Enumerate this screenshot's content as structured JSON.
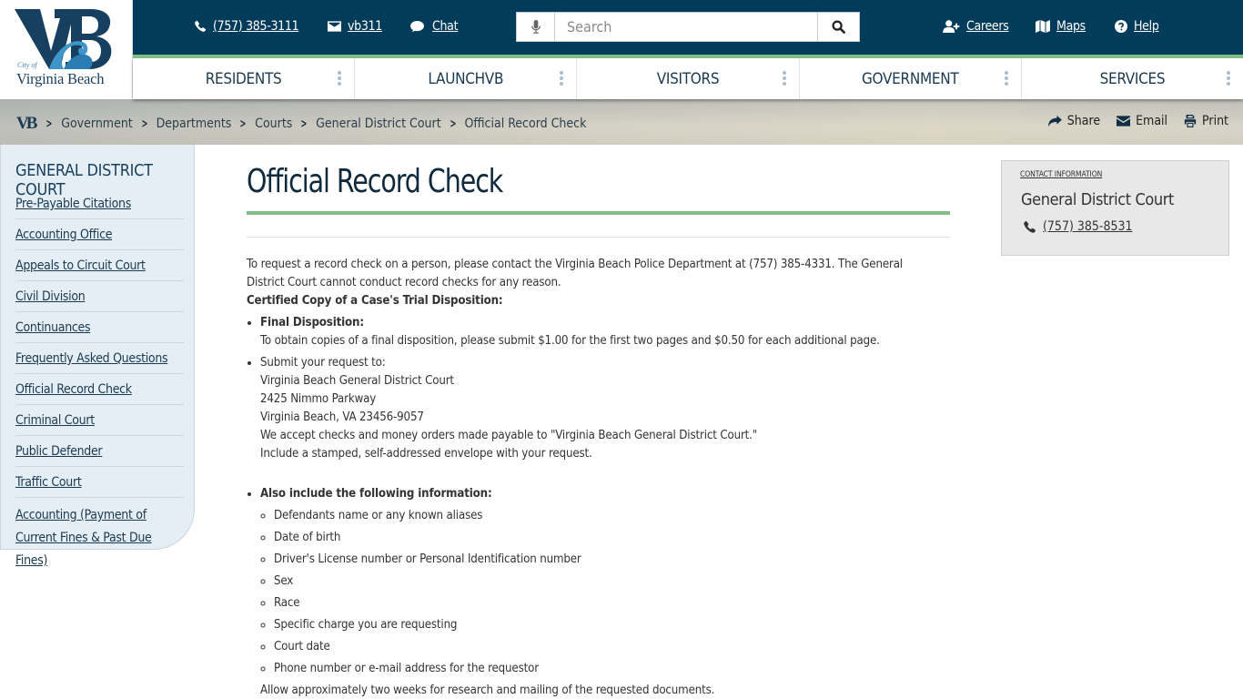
{
  "brand": {
    "logo_monogram": "VB",
    "city_of": "City of",
    "name": "Virginia Beach",
    "colors": {
      "navy": "#033c5a",
      "green_accent": "#7fbf87",
      "sidebar_bg": "#e6eef5",
      "contact_bg": "#e8e8e8"
    }
  },
  "utility": {
    "phone": {
      "icon": "phone-icon",
      "label": "(757) 385-3111"
    },
    "email": {
      "icon": "envelope-icon",
      "label": "vb311"
    },
    "chat": {
      "icon": "chat-bubble-icon",
      "label": "Chat"
    },
    "search": {
      "placeholder": "Search",
      "value": "",
      "mic_icon": "microphone-icon",
      "button_icon": "search-icon"
    },
    "careers": {
      "icon": "user-plus-icon",
      "label": "Careers"
    },
    "maps": {
      "icon": "map-icon",
      "label": "Maps"
    },
    "help": {
      "icon": "question-circle-icon",
      "label": "Help"
    }
  },
  "nav": {
    "items": [
      {
        "label": "RESIDENTS"
      },
      {
        "label": "LAUNCHVB"
      },
      {
        "label": "VISITORS"
      },
      {
        "label": "GOVERNMENT"
      },
      {
        "label": "SERVICES"
      }
    ]
  },
  "breadcrumb": {
    "home": "VB",
    "items": [
      "Government",
      "Departments",
      "Courts",
      "General District Court",
      "Official Record Check"
    ]
  },
  "page_actions": {
    "share": "Share",
    "email": "Email",
    "print": "Print"
  },
  "sidebar": {
    "title": "GENERAL DISTRICT COURT",
    "items": [
      {
        "label": "Pre-Payable Citations"
      },
      {
        "label": "Accounting Office"
      },
      {
        "label": "Appeals to Circuit Court"
      },
      {
        "label": "Civil Division"
      },
      {
        "label": "Continuances"
      },
      {
        "label": "Frequently Asked Questions"
      },
      {
        "label": "Official Record Check"
      },
      {
        "label": "Criminal Court"
      },
      {
        "label": "Public Defender"
      },
      {
        "label": "Traffic Court"
      },
      {
        "label": "Accounting (Payment of Current Fines & Past Due Fines)"
      }
    ]
  },
  "main": {
    "title": "Official Record Check",
    "intro": "To request a record check on a person, please contact the Virginia Beach Police Department at (757) 385-4331. The General District Court cannot conduct record checks for any reason.",
    "section_heading": "Certified Copy of a Case's Trial Disposition:",
    "final_disposition": {
      "heading": "Final Disposition:",
      "text": "To obtain copies of a final disposition, please submit $1.00 for the first two pages and $0.50 for each additional page."
    },
    "submit": {
      "lines": [
        "Submit your request to:",
        "Virginia Beach General District Court",
        "2425 Nimmo Parkway",
        "Virginia Beach, VA 23456-9057",
        "We accept checks and money orders made payable to \"Virginia Beach General District Court.\"",
        "Include a stamped, self-addressed envelope with your request."
      ]
    },
    "also_include": {
      "heading": "Also include the following information:",
      "items": [
        "Defendants name or any known aliases",
        "Date of birth",
        "Driver's License number or Personal Identification number",
        "Sex",
        "Race",
        "Specific charge you are requesting",
        "Court date",
        "Phone number or e-mail address for the requestor"
      ],
      "footer": "Allow approximately two weeks for research and mailing of the requested documents."
    }
  },
  "contact": {
    "kicker": "CONTACT INFORMATION",
    "name": "General District Court",
    "phone": "(757) 385-8531"
  }
}
